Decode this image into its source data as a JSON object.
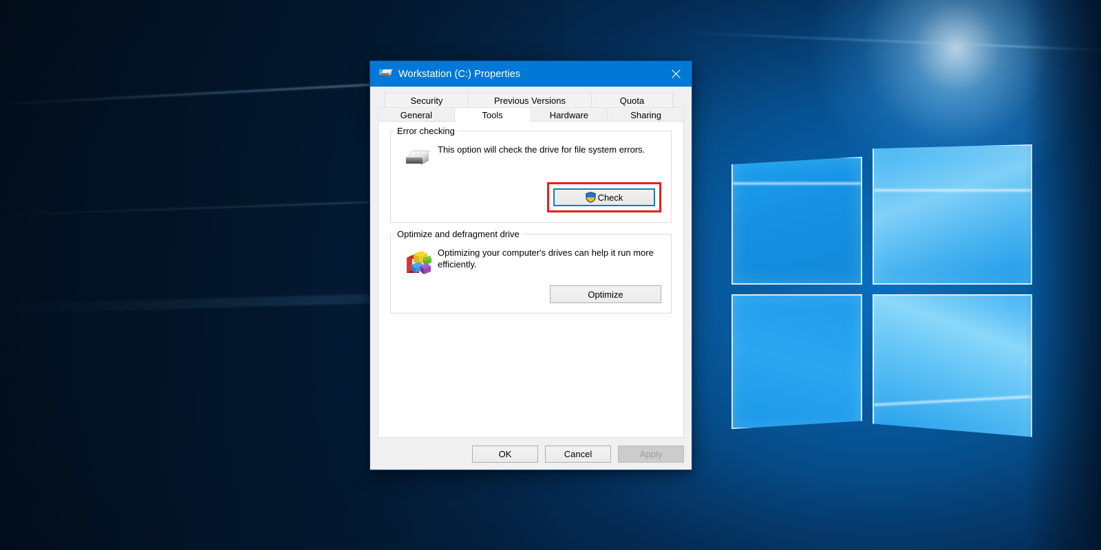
{
  "desktop": {
    "wallpaper_name": "windows-10-hero-wallpaper",
    "colors": {
      "dark_navy": "#04203f",
      "mid_blue": "#06508f",
      "bright_blue": "#45b4f2",
      "pane_edge": "#e1f5ff"
    }
  },
  "dialog": {
    "title": "Workstation (C:) Properties",
    "title_icon": "hard-drive-icon",
    "titlebar_color": "#0078d7",
    "close_icon": "close-icon",
    "tabs": {
      "row1": [
        {
          "label": "Security",
          "selected": false
        },
        {
          "label": "Previous Versions",
          "selected": false
        },
        {
          "label": "Quota",
          "selected": false
        }
      ],
      "row2": [
        {
          "label": "General",
          "selected": false
        },
        {
          "label": "Tools",
          "selected": true
        },
        {
          "label": "Hardware",
          "selected": false
        },
        {
          "label": "Sharing",
          "selected": false
        }
      ]
    },
    "groups": [
      {
        "legend": "Error checking",
        "icon": "hard-drive-icon",
        "description": "This option will check the drive for file system errors.",
        "button": {
          "label": "Check",
          "icon": "uac-shield-icon",
          "focused": true,
          "highlight_color": "#ee1c1c",
          "focus_border_color": "#1a7ab5"
        }
      },
      {
        "legend": "Optimize and defragment drive",
        "icon": "defragment-icon",
        "description": "Optimizing your computer's drives can help it run more efficiently.",
        "button": {
          "label": "Optimize",
          "icon": null,
          "focused": false
        }
      }
    ],
    "footer": {
      "ok_label": "OK",
      "cancel_label": "Cancel",
      "apply_label": "Apply",
      "apply_disabled": true
    }
  }
}
